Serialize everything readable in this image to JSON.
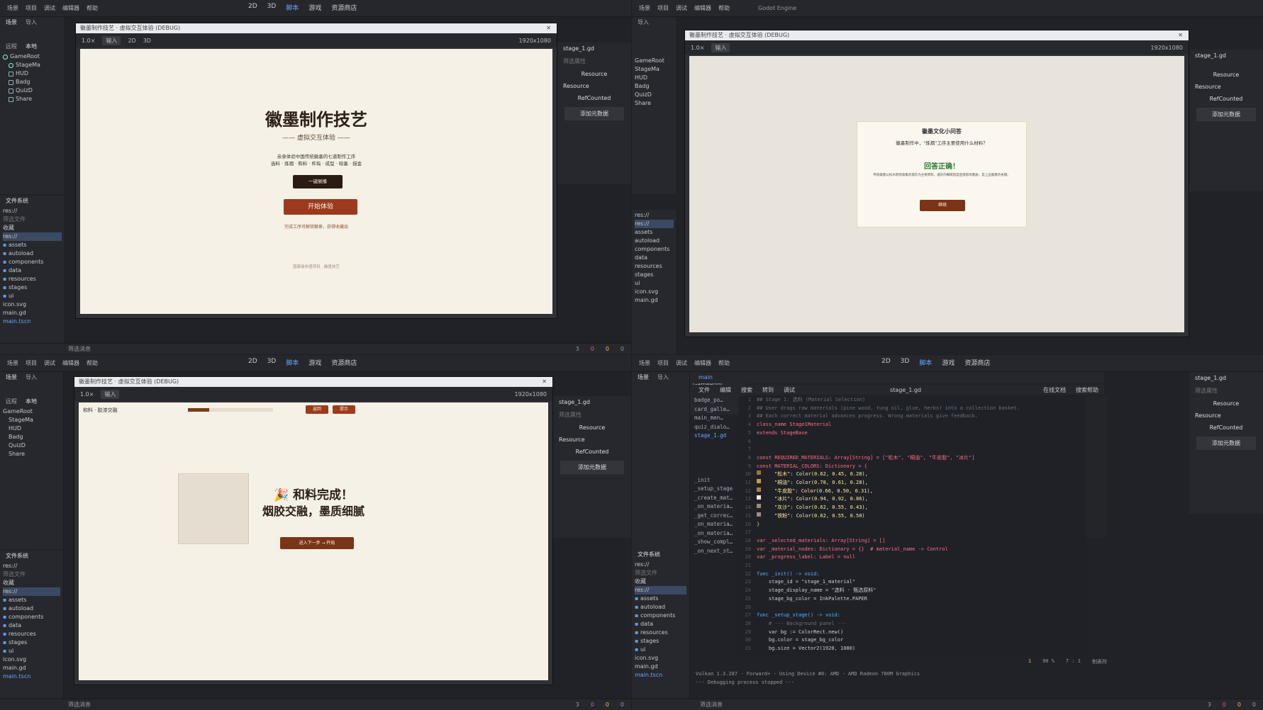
{
  "menu": [
    "场景",
    "项目",
    "调试",
    "编辑器",
    "帮助"
  ],
  "workspaces": [
    "2D",
    "3D",
    "脚本",
    "游戏",
    "资源商店"
  ],
  "window_title": "Godot Engine",
  "scene_tabs": [
    "场景",
    "导入"
  ],
  "remote_local": [
    "远程",
    "本地"
  ],
  "scene_tree": [
    "GameRoot",
    "StageMa",
    "HUD",
    "Badg",
    "QuizD",
    "Share"
  ],
  "filesystem": {
    "title": "文件系统",
    "path": "res://",
    "filter": "筛选文件",
    "favorites": "收藏",
    "root": "res://",
    "folders": [
      "assets",
      "autoload",
      "components",
      "data",
      "resources",
      "stages",
      "ui"
    ],
    "files": [
      "icon.svg",
      "main.gd",
      "main.tscn"
    ]
  },
  "game_window": {
    "title": "徽墨制作技艺 · 虚拟交互体验 (DEBUG)",
    "zoom": "1.0×",
    "input_btn": "输入",
    "resolution": "1920x1080"
  },
  "inspector": {
    "file": "stage_1.gd",
    "filter": "筛选属性",
    "resource": "Resource",
    "refcounted": "RefCounted",
    "add_meta": "添加元数据"
  },
  "bottom": {
    "filter": "筛选消息",
    "counts": [
      "3",
      "0",
      "0",
      "0"
    ]
  },
  "q1": {
    "title": "徽墨制作技艺",
    "subtitle": "—— 虚拟交互体验 ——",
    "desc1": "亲身体验中国传统徽墨的七道制作工序",
    "desc2": "选料 · 炼烟 · 和料 · 杵捣 · 成型 · 晾墨 · 描金",
    "btn_hub": "一键展播",
    "btn_start": "开始体验",
    "hint": "完成工序可解锁徽章，获得收藏品",
    "footer": "国家级非遗项目 · 徽墨技艺"
  },
  "q2": {
    "dialog_title": "徽墨文化小问答",
    "question": "徽墨制作中，\"炼烟\"工序主要使用什么材料？",
    "correct": "回答正确！",
    "explain": "传统徽墨以松木燃烧收集的烟灰为主要原料，烟灰的细腻程度直接影响墨质，是上品徽墨的关键。",
    "btn_continue": "继续"
  },
  "q3": {
    "stage": "和料 · 胶漆交融",
    "btn_a": "返回",
    "btn_b": "提示",
    "done_title": "🎉 和料完成！",
    "done_sub": "烟胶交融，墨质细腻",
    "btn_next": "进入下一步 → 杵捣"
  },
  "q4": {
    "tab": "main",
    "menu": [
      "文件",
      "编辑",
      "搜索",
      "转到",
      "调试"
    ],
    "file_title": "stage_1.gd",
    "online_docs": "在线文档",
    "search_help": "搜索帮助",
    "scripts": [
      "badge_po…",
      "card_galle…",
      "main_men…",
      "quiz_dialo…",
      "stage_1.gd"
    ],
    "methods": [
      "_init",
      "_setup_stage",
      "_create_mat…",
      "_on_materia…",
      "_get_correc…",
      "_on_materia…",
      "_on_materia…",
      "_show_compl…",
      "_on_next_st…"
    ],
    "code": [
      [
        "cm",
        "## Stage 1: 选料 (Material Selection)"
      ],
      [
        "cm",
        "## User drags raw materials (pine wood, tung oil, glue, herbs) into a collection basket."
      ],
      [
        "cm",
        "## Each correct material advances progress. Wrong materials give feedback."
      ],
      [
        "kw",
        "class_name Stage1Material"
      ],
      [
        "kw",
        "extends StageBase"
      ],
      [
        "tx",
        ""
      ],
      [
        "tx",
        ""
      ],
      [
        "kw",
        "const REQUIRED_MATERIALS: Array[String] = [\"松木\", \"桐油\", \"牛皮胶\", \"冰片\"]"
      ],
      [
        "kw",
        "const MATERIAL_COLORS: Dictionary = {"
      ],
      [
        "str",
        "    \"松木\": Color(0.62, 0.45, 0.28),"
      ],
      [
        "str",
        "    \"桐油\": Color(0.78, 0.61, 0.28),"
      ],
      [
        "str",
        "    \"牛皮胶\": Color(0.66, 0.50, 0.31),"
      ],
      [
        "str",
        "    \"冰片\": Color(0.94, 0.92, 0.86),"
      ],
      [
        "str",
        "    \"灰沙\": Color(0.62, 0.55, 0.43),"
      ],
      [
        "str",
        "    \"铁粉\": Color(0.62, 0.55, 0.50)"
      ],
      [
        "tx",
        "}"
      ],
      [
        "tx",
        ""
      ],
      [
        "kw",
        "var _selected_materials: Array[String] = []"
      ],
      [
        "kw",
        "var _material_nodes: Dictionary = {}  # material_name -> Control"
      ],
      [
        "kw",
        "var _progress_label: Label = null"
      ],
      [
        "tx",
        ""
      ],
      [
        "fn",
        "func _init() -> void:"
      ],
      [
        "tx",
        "    stage_id = \"stage_1_material\""
      ],
      [
        "tx",
        "    stage_display_name = \"选料 · 甄选原料\""
      ],
      [
        "tx",
        "    stage_bg_color = InkPalette.PAPER"
      ],
      [
        "tx",
        ""
      ],
      [
        "fn",
        "func _setup_stage() -> void:"
      ],
      [
        "cm",
        "    # --- Background panel ---"
      ],
      [
        "tx",
        "    var bg := ColorRect.new()"
      ],
      [
        "tx",
        "    bg.color = stage_bg_color"
      ],
      [
        "tx",
        "    bg.size = Vector2(1920, 1080)"
      ]
    ],
    "swatches": [
      "#9e7347",
      "#c79c47",
      "#a8804f",
      "#f0ebdb",
      "#9e8c6e",
      "#9e8c80"
    ],
    "output": "Vulkan 1.3.287 - Forward+ - Using Device #0: AMD - AMD Radeon 780M Graphics",
    "output2": "--- Debugging process stopped ---",
    "status_warn": "1",
    "status_zoom": "90 %",
    "status_pos": "7 :   1",
    "status_tab": "制表符"
  }
}
